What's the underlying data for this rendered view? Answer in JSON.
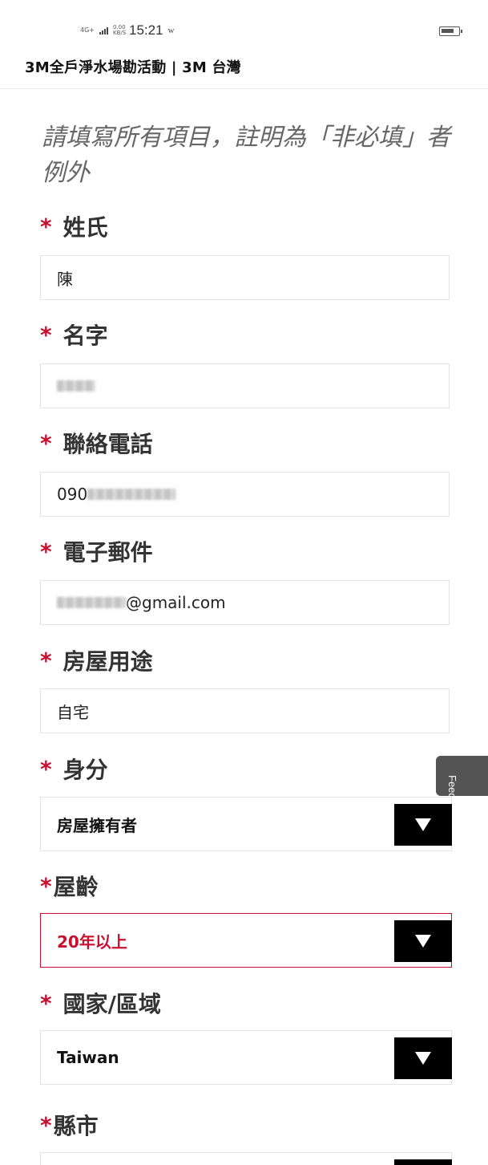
{
  "status_bar": {
    "network_label": "4G+",
    "speed_label": "0.00 KB/S",
    "time": "15:21",
    "carrier_glyph": "w",
    "battery_level": 0.8
  },
  "page": {
    "title": "3M全戶淨水場勘活動 | 3M 台灣"
  },
  "form": {
    "intro": "請填寫所有項目，註明為「非必填」者例外",
    "required_mark": "*",
    "fields": [
      {
        "label": "姓氏",
        "value": "陳"
      },
      {
        "label": "名字",
        "value": ""
      },
      {
        "label": "聯絡電話",
        "value": "090"
      },
      {
        "label": "電子郵件",
        "value": "@gmail.com"
      },
      {
        "label": "房屋用途",
        "value": "自宅"
      }
    ],
    "selects": [
      {
        "label": "身分",
        "value": "房屋擁有者"
      },
      {
        "label": "屋齡",
        "value": "20年以上",
        "state": "error"
      },
      {
        "label": "國家/區域",
        "value": "Taiwan"
      },
      {
        "label": "縣市",
        "value": ""
      }
    ]
  },
  "feedback": {
    "label": "Feedback"
  },
  "colors": {
    "required": "#c8102e",
    "select_arrow_bg": "#000000",
    "error_border": "#c8102e"
  }
}
